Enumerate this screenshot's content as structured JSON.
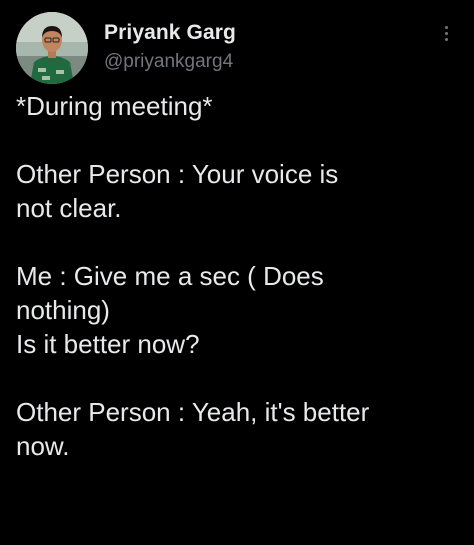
{
  "tweet": {
    "author": {
      "display_name": "Priyank Garg",
      "handle": "@priyankgarg4",
      "avatar_icon": "user-photo-avatar"
    },
    "more_icon": "vertical-dots-icon",
    "text": "*During meeting*\n\nOther Person : Your voice is\nnot clear.\n\nMe : Give me a sec ( Does\nnothing)\nIs it better now?\n\nOther Person : Yeah, it's better\nnow."
  },
  "colors": {
    "background": "#000000",
    "primary_text": "#e7e9ea",
    "secondary_text": "#71767b"
  }
}
